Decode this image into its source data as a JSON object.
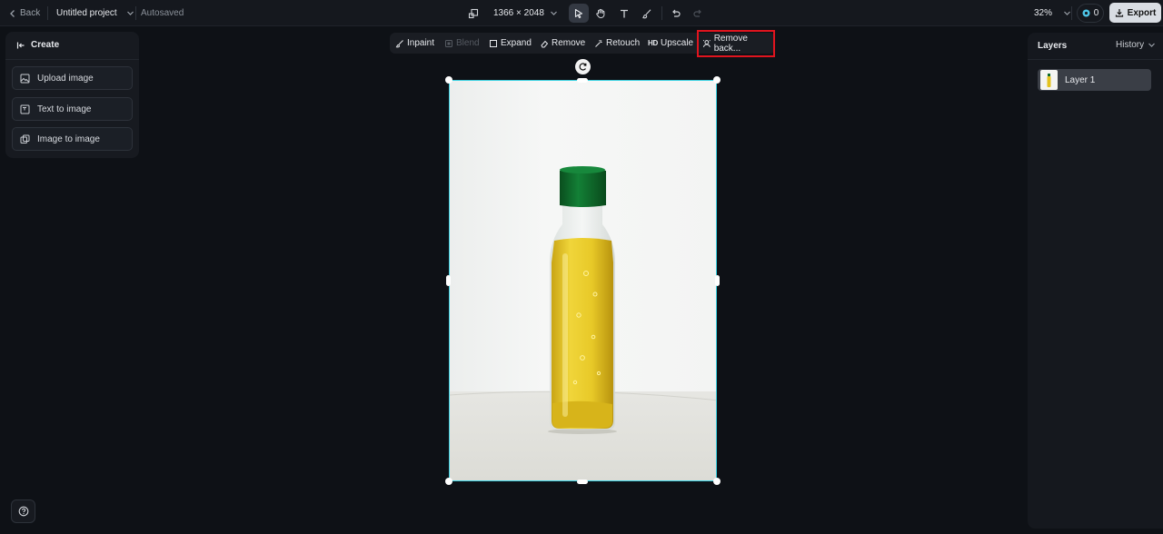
{
  "topbar": {
    "back_label": "Back",
    "project_name": "Untitled project",
    "save_status": "Autosaved",
    "dimensions": "1366 × 2048",
    "zoom": "32%",
    "credits": "0",
    "export_label": "Export"
  },
  "create_panel": {
    "title": "Create",
    "buttons": [
      "Upload image",
      "Text to image",
      "Image to image"
    ]
  },
  "context_toolbar": {
    "items": [
      "Inpaint",
      "Blend",
      "Expand",
      "Remove",
      "Retouch",
      "Upscale",
      "Remove back..."
    ],
    "upscale_badge": "HD"
  },
  "layers_panel": {
    "title": "Layers",
    "history_label": "History",
    "layers": [
      "Layer 1"
    ]
  },
  "colors": {
    "selection": "#3ad0e0",
    "highlight": "#e0141e",
    "bottle_cap": "#0f6a2a",
    "liquid": "#e3c21e"
  }
}
